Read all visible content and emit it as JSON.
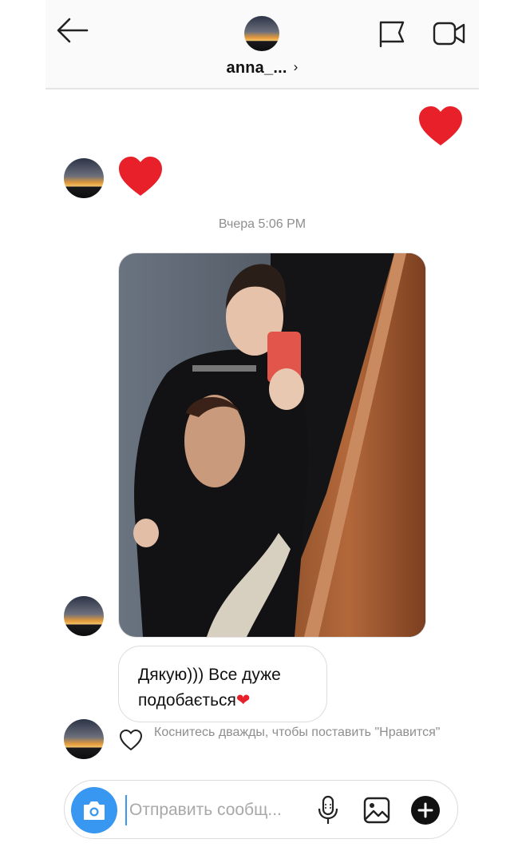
{
  "header": {
    "username": "anna_...",
    "chevron": "›",
    "back_icon": "arrow-left-icon",
    "flag_icon": "flag-icon",
    "video_icon": "video-camera-icon"
  },
  "messages": {
    "timestamp": "Вчера 5:06 PM",
    "reply_text": "Дякую))) Все дуже подобається",
    "reply_emoji": "❤",
    "like_hint": "Коснитесь дважды, чтобы поставить \"Нравится\""
  },
  "composer": {
    "placeholder": "Отправить сообщ..."
  },
  "colors": {
    "heart": "#e8202a",
    "accent": "#3897f0",
    "muted": "#8e8e8e"
  }
}
